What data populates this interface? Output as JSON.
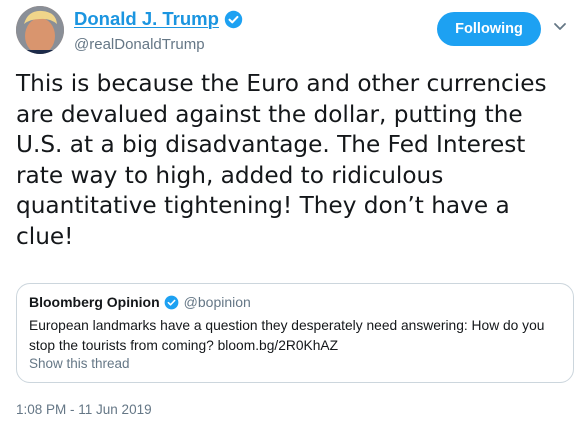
{
  "author": {
    "display_name": "Donald J. Trump",
    "handle": "@realDonaldTrump",
    "verified_icon": "verified-badge-icon",
    "avatar_icon": "profile-avatar"
  },
  "actions": {
    "follow_label": "Following",
    "more_icon": "chevron-down-icon"
  },
  "tweet": {
    "lines": [
      "This is because the Euro and other currencies",
      "are devalued against the dollar, putting the",
      "U.S. at a big disadvantage. The Fed Interest",
      "rate way to high, added to ridiculous",
      "quantitative tightening! They don’t have a",
      "clue!"
    ],
    "timestamp": "1:08 PM - 11 Jun 2019"
  },
  "quoted_tweet": {
    "display_name": "Bloomberg Opinion",
    "handle": "@bopinion",
    "verified_icon": "verified-badge-icon",
    "text_lines": [
      "European landmarks have a question they desperately need answering: How do you",
      "stop the tourists from coming? bloom.bg/2R0KhAZ"
    ],
    "show_thread": "Show this thread"
  },
  "colors": {
    "accent": "#1da1f2",
    "link": "#1b95e0",
    "secondary_text": "#657786",
    "border": "#ccd6dd"
  }
}
